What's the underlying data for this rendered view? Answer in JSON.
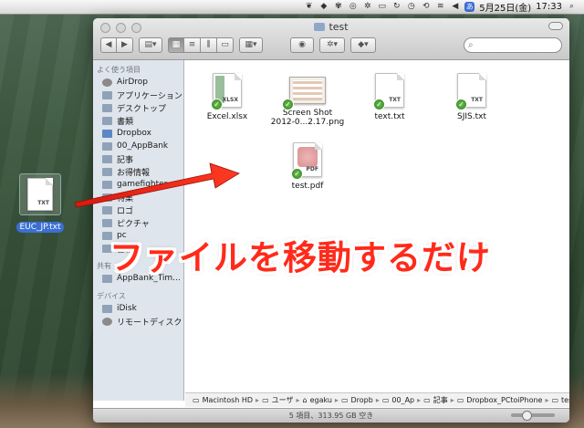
{
  "menubar": {
    "date": "5月25日(金)",
    "time": "17:33",
    "badge": "あ",
    "icons": [
      "evernote-icon",
      "dropbox-icon",
      "paw-icon",
      "spotlight-icon",
      "gear-icon",
      "display-icon",
      "sync-icon",
      "clock-icon",
      "time-machine-icon",
      "wifi-icon",
      "volume-icon",
      "input-method-icon"
    ]
  },
  "window": {
    "title": "test",
    "search_placeholder": ""
  },
  "sidebar": {
    "sections": [
      {
        "title": "よく使う項目",
        "items": [
          {
            "label": "AirDrop",
            "icon": "airdrop-icon"
          },
          {
            "label": "アプリケーション",
            "icon": "applications-icon"
          },
          {
            "label": "デスクトップ",
            "icon": "desktop-icon"
          },
          {
            "label": "書類",
            "icon": "documents-icon"
          },
          {
            "label": "Dropbox",
            "icon": "dropbox-icon"
          },
          {
            "label": "00_AppBank",
            "icon": "folder-icon"
          },
          {
            "label": "記事",
            "icon": "folder-icon"
          },
          {
            "label": "お得情報",
            "icon": "folder-icon"
          },
          {
            "label": "gamefighter",
            "icon": "folder-icon"
          },
          {
            "label": "特集",
            "icon": "folder-icon"
          },
          {
            "label": "ロゴ",
            "icon": "folder-icon"
          },
          {
            "label": "ピクチャ",
            "icon": "pictures-icon"
          },
          {
            "label": "pc",
            "icon": "folder-icon"
          },
          {
            "label": "書籍",
            "icon": "folder-icon"
          }
        ]
      },
      {
        "title": "共有",
        "items": [
          {
            "label": "AppBank_Tim...",
            "icon": "server-icon"
          }
        ]
      },
      {
        "title": "デバイス",
        "items": [
          {
            "label": "iDisk",
            "icon": "idisk-icon"
          },
          {
            "label": "リモートディスク",
            "icon": "remote-disc-icon"
          }
        ]
      }
    ]
  },
  "files": [
    {
      "name": "Excel.xlsx",
      "tag": "XLSX",
      "kind": "xlsx"
    },
    {
      "name": "Screen Shot\n2012-0...2.17.png",
      "tag": "",
      "kind": "png"
    },
    {
      "name": "text.txt",
      "tag": "TXT",
      "kind": "txt"
    },
    {
      "name": "SJIS.txt",
      "tag": "TXT",
      "kind": "txt"
    },
    {
      "name": "test.pdf",
      "tag": "PDF",
      "kind": "pdf"
    }
  ],
  "path": [
    "Macintosh HD",
    "ユーザ",
    "egaku",
    "Dropb",
    "00_Ap",
    "記事",
    "Dropbox_PCtoiPhone",
    "test"
  ],
  "status": "5 項目、313.95 GB 空き",
  "desktop_file": {
    "name": "EUC_JP.txt",
    "tag": "TXT"
  },
  "caption": "ファイルを移動するだけ",
  "colors": {
    "caption": "#ff2a1a",
    "selection": "#3b6fd1",
    "check": "#2f7d20"
  }
}
